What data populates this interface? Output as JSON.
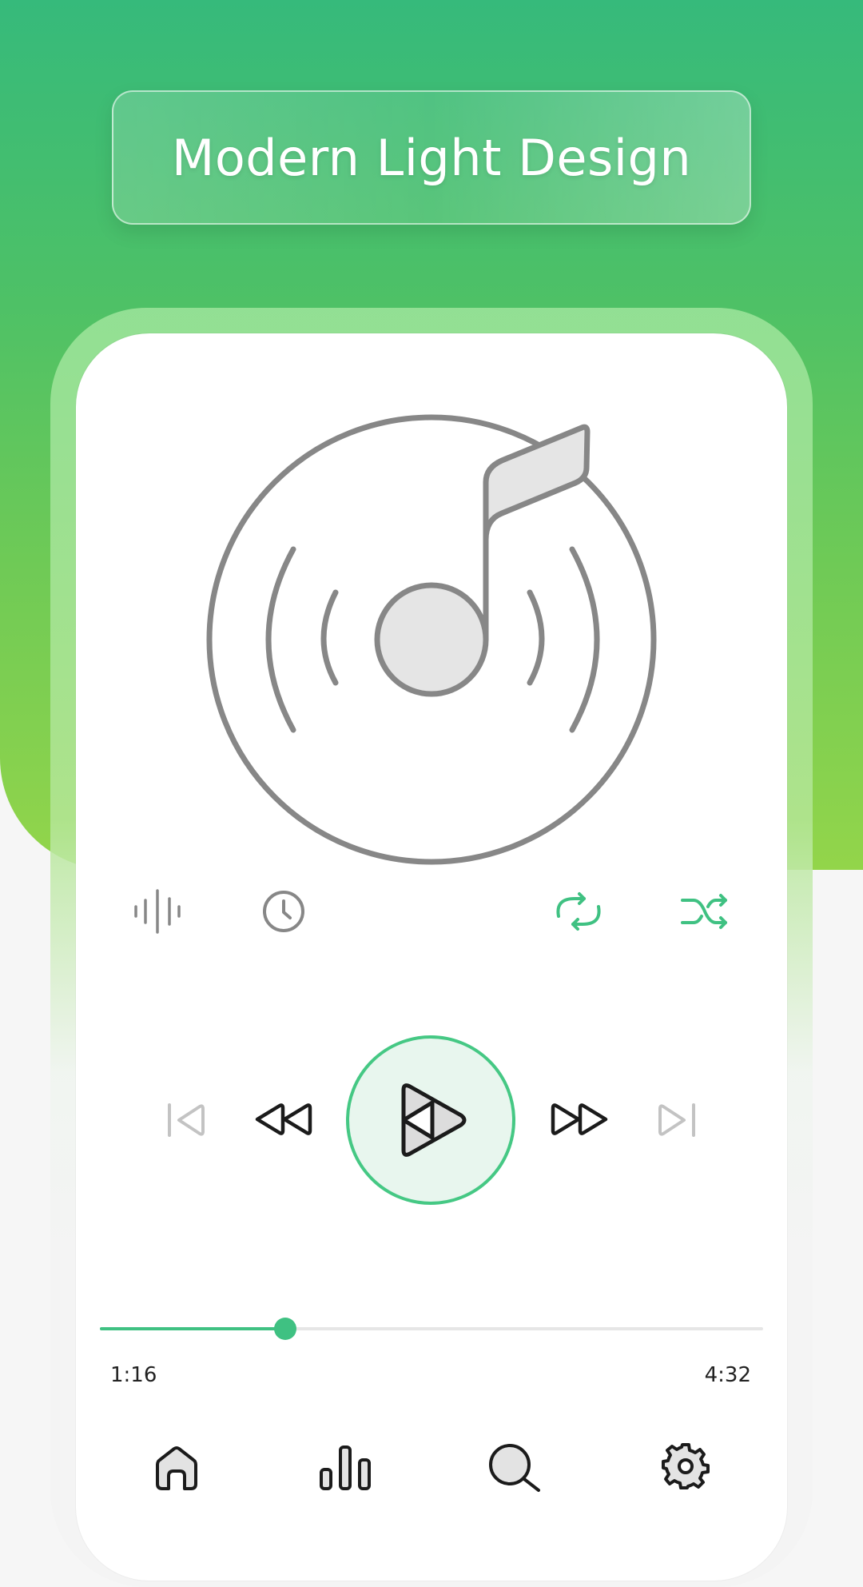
{
  "banner": {
    "title": "Modern Light Design"
  },
  "album_art": {
    "icon": "music-disc-icon"
  },
  "secondary_controls": [
    {
      "name": "equalizer-wave",
      "icon": "waveform-icon"
    },
    {
      "name": "sleep-timer",
      "icon": "clock-icon"
    },
    {
      "name": "repeat",
      "icon": "repeat-icon"
    },
    {
      "name": "shuffle",
      "icon": "shuffle-icon"
    }
  ],
  "playback_controls": [
    {
      "name": "previous-track",
      "icon": "skip-previous-icon"
    },
    {
      "name": "rewind",
      "icon": "rewind-icon"
    },
    {
      "name": "play",
      "icon": "play-icon"
    },
    {
      "name": "fast-forward",
      "icon": "fast-forward-icon"
    },
    {
      "name": "next-track",
      "icon": "skip-next-icon"
    }
  ],
  "progress": {
    "elapsed": "1:16",
    "duration": "4:32",
    "fraction": 0.279
  },
  "bottom_nav": [
    {
      "name": "home",
      "icon": "home-icon"
    },
    {
      "name": "charts",
      "icon": "bar-chart-icon"
    },
    {
      "name": "search",
      "icon": "search-icon"
    },
    {
      "name": "settings",
      "icon": "gear-icon"
    }
  ],
  "colors": {
    "accent": "#3fc182",
    "gradient_top": "#36ba7b",
    "gradient_bottom": "#93d54a",
    "icon_gray": "#878787",
    "icon_dark": "#1b1b1b"
  }
}
